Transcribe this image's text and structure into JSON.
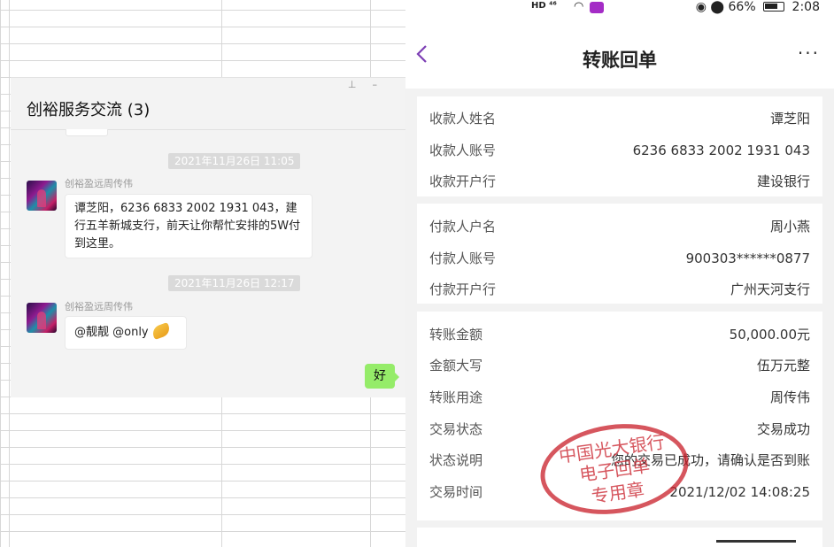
{
  "chat": {
    "title": "创裕服务交流 (3)",
    "pin_icon": "pin-icon",
    "minimize_icon": "minimize-icon",
    "messages": [
      {
        "time": "2021年11月26日 11:05",
        "sender": "创裕盈远周传伟",
        "text": "谭芝阳，6236 6833 2002 1931 043，建行五羊新城支行，前天让你帮忙安排的5W付到这里。"
      },
      {
        "time": "2021年11月26日 12:17",
        "sender": "创裕盈远周传伟",
        "text": "@靓靓 @only",
        "emoji": "praying-hands-emoji"
      }
    ],
    "my_reply": "好"
  },
  "phone": {
    "statusbar": {
      "left_icons": "HD ⁴⁶",
      "eye_icon": "eye-icon",
      "location_icon": "location-icon",
      "battery": "66%",
      "time": "2:08"
    },
    "nav": {
      "back_icon": "chevron-left-icon",
      "title": "转账回单",
      "more_label": "···"
    },
    "sections": [
      [
        {
          "k": "收款人姓名",
          "v": "谭芝阳"
        },
        {
          "k": "收款人账号",
          "v": "6236 6833 2002 1931 043"
        },
        {
          "k": "收款开户行",
          "v": "建设银行"
        }
      ],
      [
        {
          "k": "付款人户名",
          "v": "周小燕"
        },
        {
          "k": "付款人账号",
          "v": "900303******0877"
        },
        {
          "k": "付款开户行",
          "v": "广州天河支行"
        }
      ],
      [
        {
          "k": "转账金额",
          "v": "50,000.00元"
        },
        {
          "k": "金额大写",
          "v": "伍万元整"
        },
        {
          "k": "转账用途",
          "v": "周传伟"
        },
        {
          "k": "交易状态",
          "v": "交易成功"
        },
        {
          "k": "状态说明",
          "v": "您的交易已成功，请确认是否到账"
        },
        {
          "k": "交易时间",
          "v": "2021/12/02 14:08:25"
        }
      ]
    ],
    "stamp": {
      "line1": "中国光大银行",
      "line2": "电子回单",
      "line3": "专用章"
    }
  }
}
